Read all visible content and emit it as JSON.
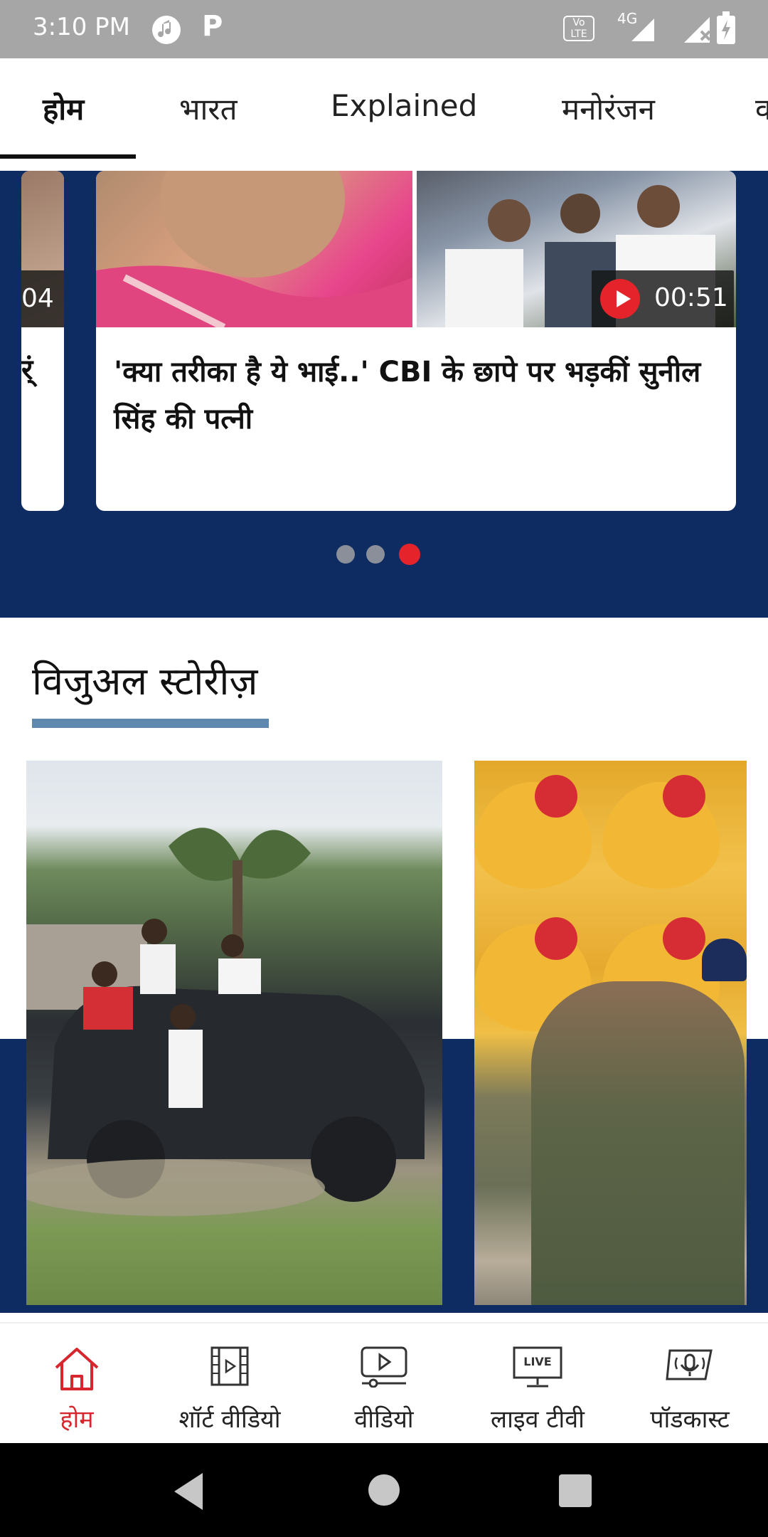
{
  "status_bar": {
    "time": "3:10 PM",
    "icons": [
      "music-app-icon",
      "p-app-icon",
      "volte-icon",
      "4g-signal-icon",
      "no-signal-icon",
      "battery-charging-icon"
    ],
    "volte_label": "Vo LTE",
    "network_label": "4G"
  },
  "tabs": [
    {
      "label": "होम",
      "active": true
    },
    {
      "label": "भारत",
      "active": false
    },
    {
      "label": "Explained",
      "active": false
    },
    {
      "label": "मनोरंजन",
      "active": false
    },
    {
      "label": "व",
      "active": false
    }
  ],
  "carousel": {
    "left_card": {
      "duration_partial": "04",
      "title_partial": "र्ं"
    },
    "main_card": {
      "duration": "00:51",
      "title": "'क्या तरीका है ये भाई..' CBI के छापे पर भड़कीं सुनील सिंह की पत्नी"
    },
    "page_count": 3,
    "active_index": 2
  },
  "visual_stories": {
    "title": "विजुअल स्टोरीज़"
  },
  "bottom_nav": [
    {
      "label": "होम",
      "icon": "home-icon",
      "active": true
    },
    {
      "label": "शॉर्ट वीडियो",
      "icon": "film-strip-icon",
      "active": false
    },
    {
      "label": "वीडियो",
      "icon": "video-play-icon",
      "active": false
    },
    {
      "label": "लाइव टीवी",
      "icon": "live-tv-icon",
      "active": false,
      "badge": "LIVE"
    },
    {
      "label": "पॉडकास्ट",
      "icon": "podcast-mic-icon",
      "active": false
    }
  ],
  "colors": {
    "brand_navy": "#0e2c62",
    "accent_red": "#e5232b",
    "underline_blue": "#5f88ae",
    "status_bar_gray": "#a6a6a6"
  }
}
